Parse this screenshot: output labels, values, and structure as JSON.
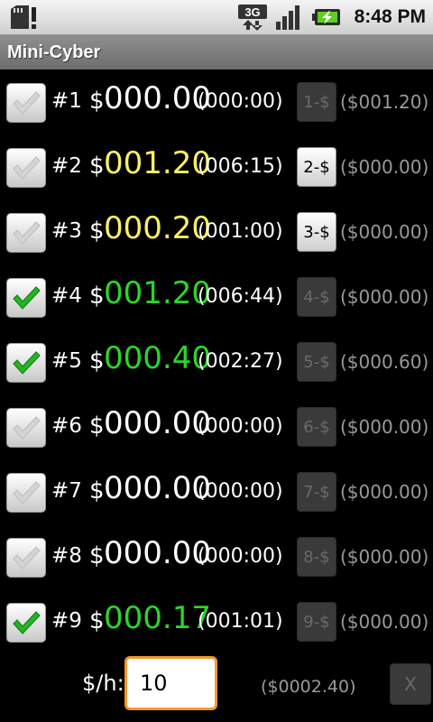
{
  "status_bar": {
    "time": "8:48 PM",
    "network_label": "3G",
    "icons": [
      "sd-card-alert-icon",
      "3g-data-icon",
      "signal-strength-icon",
      "battery-charging-icon"
    ]
  },
  "app": {
    "title": "Mini-Cyber"
  },
  "colors": {
    "white": "#ffffff",
    "yellow": "#ffef5f",
    "green": "#2bd52b",
    "accent": "#f09a28"
  },
  "rows": [
    {
      "num": "#1",
      "dollar": "$",
      "amount": "000.00",
      "amount_color": "white",
      "time": "(000:00)",
      "checked": false,
      "button_label": "1-$",
      "button_enabled": false,
      "paid": "($001.20)"
    },
    {
      "num": "#2",
      "dollar": "$",
      "amount": "001.20",
      "amount_color": "yellow",
      "time": "(006:15)",
      "checked": false,
      "button_label": "2-$",
      "button_enabled": true,
      "paid": "($000.00)"
    },
    {
      "num": "#3",
      "dollar": "$",
      "amount": "000.20",
      "amount_color": "yellow",
      "time": "(001:00)",
      "checked": false,
      "button_label": "3-$",
      "button_enabled": true,
      "paid": "($000.00)"
    },
    {
      "num": "#4",
      "dollar": "$",
      "amount": "001.20",
      "amount_color": "green",
      "time": "(006:44)",
      "checked": true,
      "button_label": "4-$",
      "button_enabled": false,
      "paid": "($000.00)"
    },
    {
      "num": "#5",
      "dollar": "$",
      "amount": "000.40",
      "amount_color": "green",
      "time": "(002:27)",
      "checked": true,
      "button_label": "5-$",
      "button_enabled": false,
      "paid": "($000.60)"
    },
    {
      "num": "#6",
      "dollar": "$",
      "amount": "000.00",
      "amount_color": "white",
      "time": "(000:00)",
      "checked": false,
      "button_label": "6-$",
      "button_enabled": false,
      "paid": "($000.00)"
    },
    {
      "num": "#7",
      "dollar": "$",
      "amount": "000.00",
      "amount_color": "white",
      "time": "(000:00)",
      "checked": false,
      "button_label": "7-$",
      "button_enabled": false,
      "paid": "($000.00)"
    },
    {
      "num": "#8",
      "dollar": "$",
      "amount": "000.00",
      "amount_color": "white",
      "time": "(000:00)",
      "checked": false,
      "button_label": "8-$",
      "button_enabled": false,
      "paid": "($000.00)"
    },
    {
      "num": "#9",
      "dollar": "$",
      "amount": "000.17",
      "amount_color": "green",
      "time": "(001:01)",
      "checked": true,
      "button_label": "9-$",
      "button_enabled": false,
      "paid": "($000.00)"
    }
  ],
  "footer": {
    "rate_label": "$/h:",
    "rate_value": "10",
    "total": "($0002.40)",
    "clear_label": "X"
  }
}
